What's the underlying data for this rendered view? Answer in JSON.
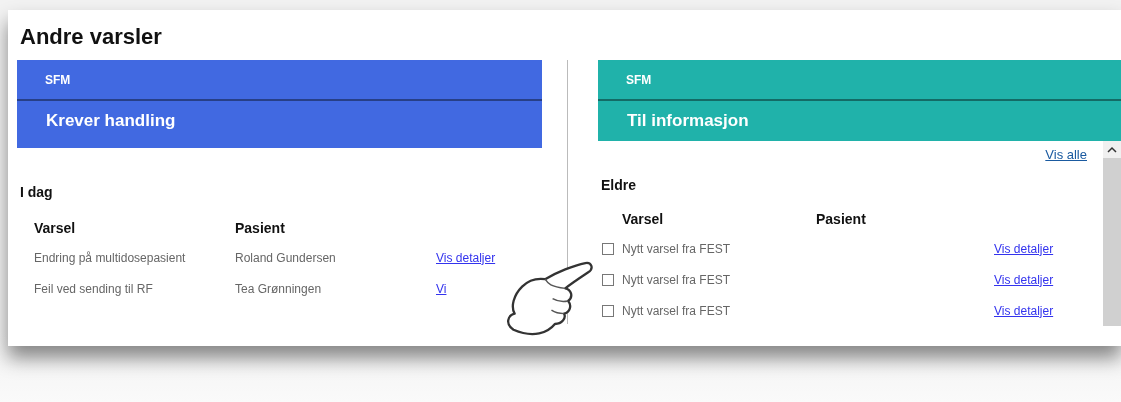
{
  "title": "Andre varsler",
  "panels": [
    {
      "kind": "action",
      "color": "#4169e1",
      "category": "SFM",
      "heading": "Krever handling",
      "section": "I dag",
      "columns": [
        "Varsel",
        "Pasient"
      ],
      "rows": [
        {
          "alert": "Endring på multidosepasient",
          "patient": "Roland Gundersen",
          "link": "Vis detaljer"
        },
        {
          "alert": "Feil ved sending til RF",
          "patient": "Tea Grønningen",
          "link": "Vi"
        }
      ]
    },
    {
      "kind": "info",
      "color": "#20b2aa",
      "category": "SFM",
      "heading": "Til informasjon",
      "view_all": "Vis alle",
      "section": "Eldre",
      "columns": [
        "Varsel",
        "Pasient"
      ],
      "rows": [
        {
          "checked": false,
          "alert": "Nytt varsel fra FEST",
          "link": "Vis detaljer"
        },
        {
          "checked": false,
          "alert": "Nytt varsel fra FEST",
          "link": "Vis detaljer"
        },
        {
          "checked": false,
          "alert": "Nytt varsel fra FEST",
          "link": "Vis detaljer"
        }
      ]
    }
  ]
}
